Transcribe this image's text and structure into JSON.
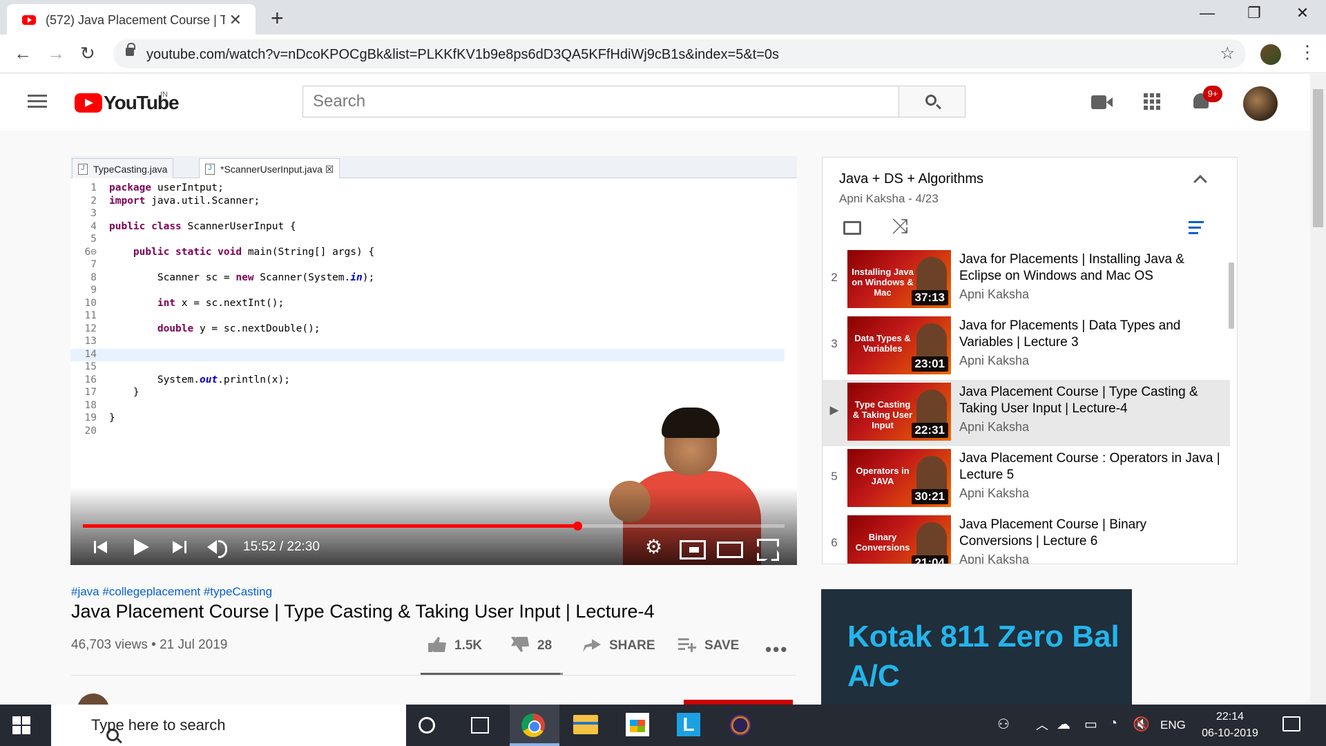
{
  "browser": {
    "tab_title": "(572) Java Placement Course | Ty",
    "tab_close": "✕",
    "new_tab": "+",
    "url": "youtube.com/watch?v=nDcoKPOCgBk&list=PLKKfKV1b9e8ps6dD3QA5KFfHdiWj9cB1s&index=5&t=0s",
    "window_buttons": [
      "—",
      "❐",
      "✕"
    ],
    "nav_icons": [
      "←",
      "→",
      "↻"
    ],
    "star": "☆",
    "menu": "⋮"
  },
  "youtube": {
    "logo_text": "YouTube",
    "region": "IN",
    "search_placeholder": "Search",
    "notification_badge": "9+"
  },
  "editor": {
    "tabs": [
      "TypeCasting.java",
      "*ScannerUserInput.java"
    ],
    "tab_close": "☒",
    "lines": [
      {
        "n": "1",
        "t": "package userIntput;"
      },
      {
        "n": "2",
        "t": "import java.util.Scanner;"
      },
      {
        "n": "3",
        "t": ""
      },
      {
        "n": "4",
        "t": "public class ScannerUserInput {"
      },
      {
        "n": "5",
        "t": ""
      },
      {
        "n": "6⊖",
        "t": "    public static void main(String[] args) {"
      },
      {
        "n": "7",
        "t": ""
      },
      {
        "n": "8",
        "t": "        Scanner sc = new Scanner(System.in);"
      },
      {
        "n": "9",
        "t": ""
      },
      {
        "n": "10",
        "t": "        int x = sc.nextInt();"
      },
      {
        "n": "11",
        "t": ""
      },
      {
        "n": "12",
        "t": "        double y = sc.nextDouble();"
      },
      {
        "n": "13",
        "t": ""
      },
      {
        "n": "14",
        "t": ""
      },
      {
        "n": "15",
        "t": ""
      },
      {
        "n": "16",
        "t": "        System.out.println(x);"
      },
      {
        "n": "17",
        "t": "    }"
      },
      {
        "n": "18",
        "t": ""
      },
      {
        "n": "19",
        "t": "}"
      },
      {
        "n": "20",
        "t": ""
      }
    ],
    "cursor_line": 14
  },
  "player": {
    "current_time": "15:52",
    "duration": "22:30",
    "time_display": "15:52 / 22:30",
    "progress_fraction": 0.705,
    "gear": "⚙"
  },
  "video": {
    "hashtags": "#java #collegeplacement #typeCasting",
    "title": "Java Placement Course | Type Casting & Taking User Input | Lecture-4",
    "meta": "46,703 views • 21 Jul 2019",
    "likes": "1.5K",
    "dislikes": "28",
    "share": "SHARE",
    "save": "SAVE",
    "more": "•••",
    "like_ratio": 0.98
  },
  "playlist": {
    "title": "Java + DS + Algorithms",
    "subtitle": "Apni Kaksha - 4/23",
    "shuffle": "⤨",
    "items": [
      {
        "index": "2",
        "title": "Java for Placements | Installing Java & Eclipse on Windows and Mac OS",
        "channel": "Apni Kaksha",
        "duration": "37:13",
        "thumb_text": "Installing Java on Windows & Mac"
      },
      {
        "index": "3",
        "title": "Java for Placements | Data Types and Variables | Lecture 3",
        "channel": "Apni Kaksha",
        "duration": "23:01",
        "thumb_text": "Data Types & Variables"
      },
      {
        "index": "▶",
        "title": "Java Placement Course | Type Casting & Taking User Input | Lecture-4",
        "channel": "Apni Kaksha",
        "duration": "22:31",
        "thumb_text": "Type Casting & Taking User Input"
      },
      {
        "index": "5",
        "title": "Java Placement Course : Operators in Java | Lecture 5",
        "channel": "Apni Kaksha",
        "duration": "30:21",
        "thumb_text": "Operators in JAVA"
      },
      {
        "index": "6",
        "title": "Java Placement Course | Binary Conversions | Lecture 6",
        "channel": "Apni Kaksha",
        "duration": "21:04",
        "thumb_text": "Binary Conversions"
      }
    ]
  },
  "ad": {
    "text": "Kotak 811 Zero Bal A/C"
  },
  "taskbar": {
    "search_placeholder": "Type here to search",
    "lang": "ENG",
    "time": "22:14",
    "date": "06-10-2019",
    "l_app": "L"
  },
  "colors": {
    "youtube_red": "#ff0000",
    "link_blue": "#065fd4",
    "ad_text": "#23b5ec",
    "taskbar": "#262a33"
  }
}
